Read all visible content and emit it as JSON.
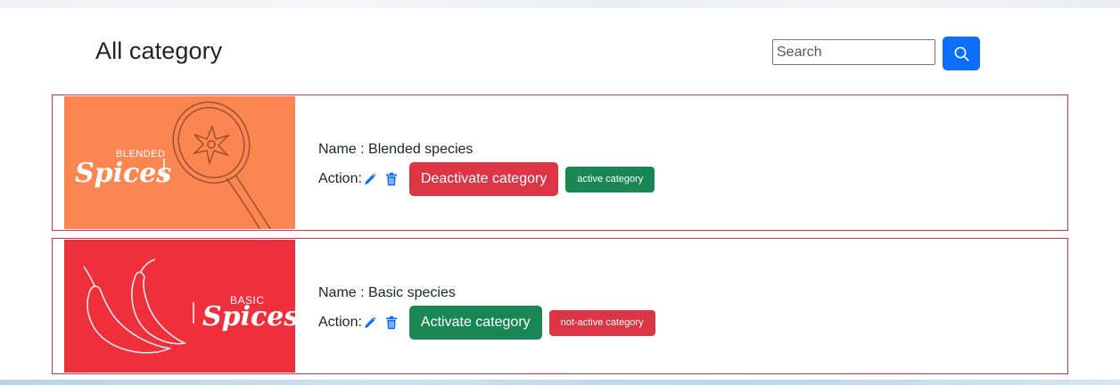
{
  "header": {
    "title": "All category",
    "search_placeholder": "Search",
    "search_value": "",
    "search_icon": "search-icon"
  },
  "categories": [
    {
      "image_text_top": "BLENDED",
      "image_text_main": "Spices",
      "image_bg": "#fb8652",
      "name_prefix": "Name : ",
      "name": "Blended species",
      "action_label": "Action:",
      "edit_icon": "pencil-icon",
      "delete_icon": "trash-icon",
      "toggle_label": "Deactivate category",
      "toggle_color": "#dc3545",
      "status_label": "active category",
      "status_color": "#198754"
    },
    {
      "image_text_top": "BASIC",
      "image_text_main": "Spices",
      "image_bg": "#ef2f3c",
      "name_prefix": "Name : ",
      "name": "Basic species",
      "action_label": "Action:",
      "edit_icon": "pencil-icon",
      "delete_icon": "trash-icon",
      "toggle_label": "Activate category",
      "toggle_color": "#198754",
      "status_label": "not-active category",
      "status_color": "#dc3545"
    }
  ],
  "colors": {
    "primary": "#0d6efd",
    "danger": "#dc3545",
    "success": "#198754",
    "card_border": "#dc3545"
  }
}
